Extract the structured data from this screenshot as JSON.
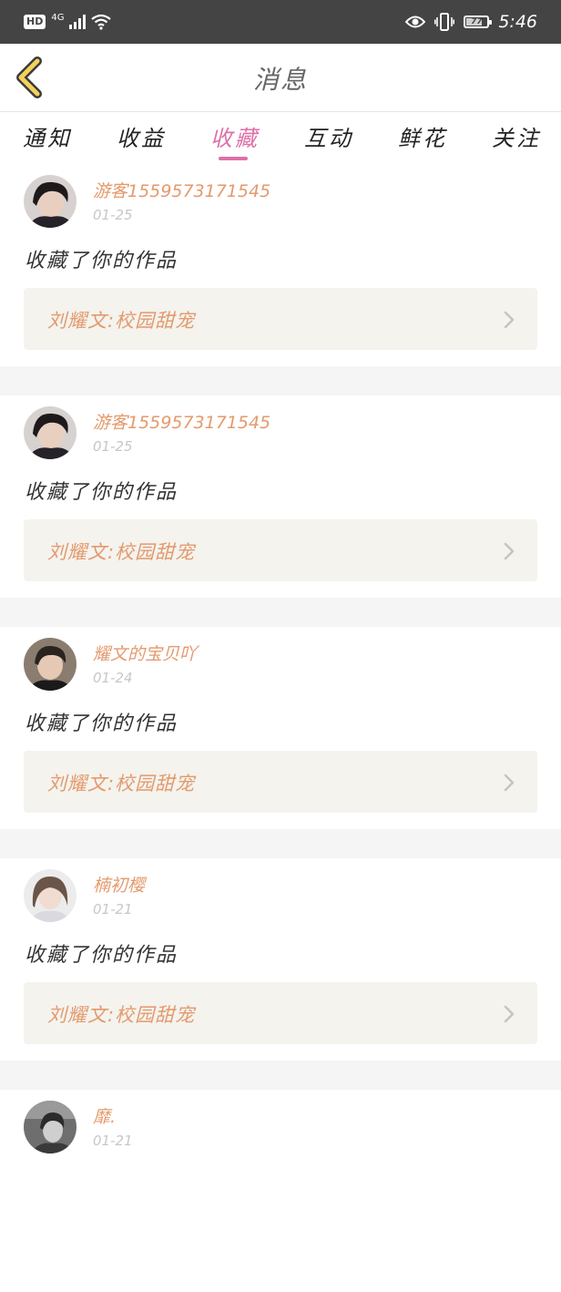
{
  "status_bar": {
    "hd": "HD",
    "network": "4G",
    "battery": "77",
    "battery_level": 0.77,
    "time": "5:46"
  },
  "header": {
    "title": "消息"
  },
  "tabs": [
    {
      "label": "通知",
      "active": false
    },
    {
      "label": "收益",
      "active": false
    },
    {
      "label": "收藏",
      "active": true
    },
    {
      "label": "互动",
      "active": false
    },
    {
      "label": "鲜花",
      "active": false
    },
    {
      "label": "关注",
      "active": false
    }
  ],
  "feed": [
    {
      "username": "游客1559573171545",
      "date": "01-25",
      "action": "收藏了你的作品",
      "work": "刘耀文:校园甜宠"
    },
    {
      "username": "游客1559573171545",
      "date": "01-25",
      "action": "收藏了你的作品",
      "work": "刘耀文:校园甜宠"
    },
    {
      "username": "耀文的宝贝吖",
      "date": "01-24",
      "action": "收藏了你的作品",
      "work": "刘耀文:校园甜宠"
    },
    {
      "username": "楠初樱",
      "date": "01-21",
      "action": "收藏了你的作品",
      "work": "刘耀文:校园甜宠"
    },
    {
      "username": "靡.",
      "date": "01-21"
    }
  ],
  "colors": {
    "accent": "#de6fa8",
    "name": "#e49a6d",
    "status_bar": "#444444",
    "work_box": "#f4f3ee"
  }
}
